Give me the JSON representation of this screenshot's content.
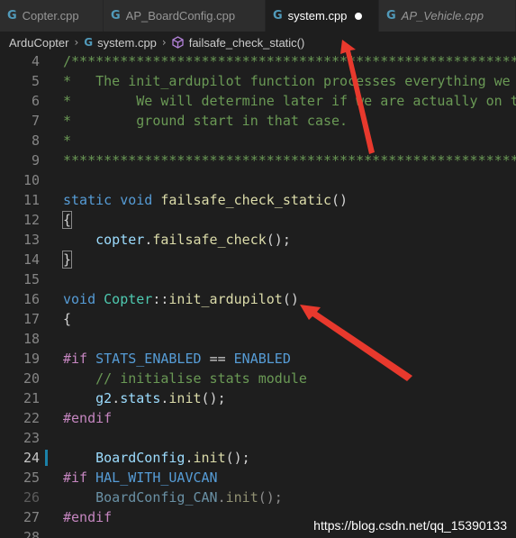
{
  "tabs": [
    {
      "label": "Copter.cpp",
      "icon": "cpp-file-icon",
      "active": false
    },
    {
      "label": "AP_BoardConfig.cpp",
      "icon": "cpp-file-icon",
      "active": false
    },
    {
      "label": "system.cpp",
      "icon": "cpp-file-icon",
      "active": true,
      "modified": true
    },
    {
      "label": "AP_Vehicle.cpp",
      "icon": "cpp-file-icon",
      "active": false
    }
  ],
  "breadcrumb": {
    "folder": "ArduCopter",
    "file": "system.cpp",
    "symbol": "failsafe_check_static()"
  },
  "editor": {
    "current_line": 24,
    "line_numbers": [
      "4",
      "5",
      "6",
      "7",
      "8",
      "9",
      "10",
      "11",
      "12",
      "13",
      "14",
      "15",
      "16",
      "17",
      "18",
      "19",
      "20",
      "21",
      "22",
      "23",
      "24",
      "25",
      "26",
      "27",
      "28"
    ],
    "lines": {
      "l4": "/*****************************************************************************",
      "l5": "*   The init_ardupilot function processes everything we need for an in-air restart",
      "l6": "*        We will determine later if we are actually on the ground and process a",
      "l7": "*        ground start in that case.",
      "l8": "*",
      "l9": "*****************************************************************************/",
      "l11_kw": "static void",
      "l11_fn": "failsafe_check_static",
      "l11_p": "()",
      "l12": "{",
      "l13_obj": "copter",
      "l13_dot": ".",
      "l13_fn": "failsafe_check",
      "l13_end": "();",
      "l14": "}",
      "l16_kw": "void",
      "l16_cls": "Copter",
      "l16_sep": "::",
      "l16_fn": "init_ardupilot",
      "l16_p": "()",
      "l17": "{",
      "l19_dir": "#if",
      "l19_m1": "STATS_ENABLED",
      "l19_op": "==",
      "l19_m2": "ENABLED",
      "l20": "// initialise stats module",
      "l21_obj": "g2",
      "l21_dot1": ".",
      "l21_obj2": "stats",
      "l21_dot2": ".",
      "l21_fn": "init",
      "l21_end": "();",
      "l22": "#endif",
      "l24_obj": "BoardConfig",
      "l24_dot": ".",
      "l24_fn": "init",
      "l24_end": "();",
      "l25_dir": "#if",
      "l25_m": "HAL_WITH_UAVCAN",
      "l26_obj": "BoardConfig_CAN",
      "l26_dot": ".",
      "l26_fn": "init",
      "l26_end": "();",
      "l27": "#endif"
    }
  },
  "watermark": "https://blog.csdn.net/qq_15390133",
  "colors": {
    "background": "#1e1e1e",
    "keyword": "#569cd6",
    "function": "#dcdcaa",
    "type": "#4ec9b0",
    "comment": "#6a9955",
    "preprocessor": "#c586c0",
    "annotation_arrow": "#e8392d"
  }
}
